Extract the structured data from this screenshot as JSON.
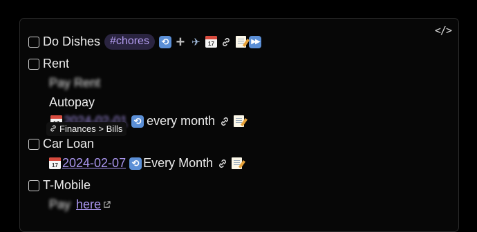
{
  "code_toggle": "</>",
  "tasks": [
    {
      "title": "Do Dishes",
      "tag": "#chores",
      "icons": [
        "repeat-icon",
        "plus-icon",
        "airplane-icon",
        "calendar-icon",
        "link-icon",
        "memo-icon",
        "fast-forward-icon"
      ]
    },
    {
      "title": "Rent",
      "lines": {
        "blurred_line": "Pay Rent",
        "autopay": "Autopay",
        "date_blurred": "2024-02-01",
        "recurrence": "every month"
      }
    },
    {
      "title": "Car Loan",
      "date": "2024-02-07",
      "recurrence": "Every Month"
    },
    {
      "title": "T-Mobile",
      "blurred_prefix": "Pay",
      "link_label": "here"
    }
  ],
  "tooltip": {
    "text": "Finances > Bills"
  },
  "colors": {
    "tag_bg": "#2a2440",
    "tag_fg": "#b39cf0",
    "link": "#a995ee",
    "recur_icon_bg": "#5b8fd6"
  }
}
